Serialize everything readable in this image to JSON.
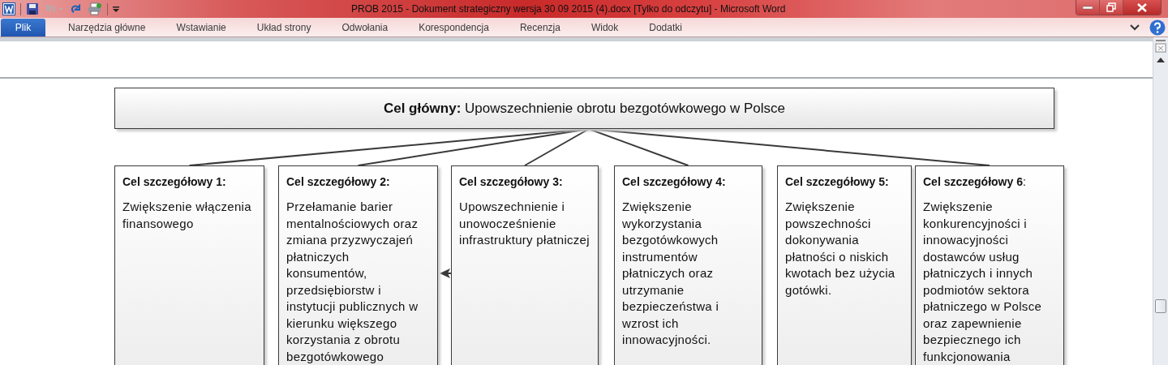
{
  "window": {
    "title": "PROB 2015 - Dokument strategiczny wersja 30 09 2015 (4).docx [Tylko do odczytu]  -  Microsoft Word"
  },
  "quick_access": {
    "undo_disabled": true
  },
  "tabs": [
    {
      "label": "Plik",
      "selected": true
    },
    {
      "label": "Narzędzia główne",
      "selected": false
    },
    {
      "label": "Wstawianie",
      "selected": false
    },
    {
      "label": "Układ strony",
      "selected": false
    },
    {
      "label": "Odwołania",
      "selected": false
    },
    {
      "label": "Korespondencja",
      "selected": false
    },
    {
      "label": "Recenzja",
      "selected": false
    },
    {
      "label": "Widok",
      "selected": false
    },
    {
      "label": "Dodatki",
      "selected": false
    }
  ],
  "diagram": {
    "main_goal": {
      "text": "**Cel główny:** Upowszechnienie obrotu bezgotówkowego w Polsce"
    },
    "goals": [
      {
        "title": "Cel szczegółowy 1:",
        "title_bold": true,
        "linked_to_main": true,
        "arrow_to_previous": false,
        "text": "Zwiększenie włączenia finansowego"
      },
      {
        "title": "Cel szczegółowy 2:",
        "title_bold": true,
        "linked_to_main": true,
        "arrow_to_previous": false,
        "text": "Przełamanie barier mentalnościowych oraz zmiana przyzwyczajeń płatniczych konsumentów, przedsiębiorstw i instytucji publicznych w kierunku większego korzystania z obrotu bezgotówkowego"
      },
      {
        "title": "Cel szczegółowy 3:",
        "title_bold": true,
        "linked_to_main": true,
        "arrow_to_previous": true,
        "text": "Upowszechnienie i unowocześnienie infrastruktury płatniczej"
      },
      {
        "title": "Cel szczegółowy 4:",
        "title_bold": true,
        "linked_to_main": true,
        "arrow_to_previous": false,
        "text": "Zwiększenie wykorzystania bezgotówkowych instrumentów płatniczych oraz utrzymanie bezpieczeństwa i wzrost ich innowacyjności."
      },
      {
        "title": "Cel szczegółowy 5:",
        "title_bold": true,
        "linked_to_main": false,
        "arrow_to_previous": false,
        "text": "Zwiększenie powszechności dokonywania płatności o niskich kwotach bez użycia gotówki."
      },
      {
        "title": "**Cel szczegółowy 6**:",
        "title_bold": false,
        "linked_to_main": true,
        "arrow_to_previous": false,
        "text": "Zwiększenie konkurencyjności i innowacyjności dostawców usług płatniczych i innych podmiotów sektora płatniczego w Polsce oraz zapewnienie bezpiecznego ich funkcjonowania"
      }
    ]
  }
}
